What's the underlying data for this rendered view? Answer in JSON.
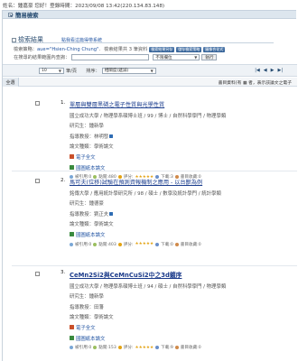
{
  "header": {
    "user_text": "姓名：鍾嘉豪 您好！登錄時間：2023/09/08 13:42(220.134.83.148)"
  },
  "panel": {
    "title": "簡易檢索"
  },
  "results": {
    "title": "檢索結果",
    "save_link": "點我看這篇得帶系統"
  },
  "query": {
    "prefix": "檢索策略：",
    "expr": "auе=\"Hsien-Ching Chung\"",
    "suffix": ".",
    "summary": "檢索結果共 3 筆資料",
    "buttons": [
      "檢索結果另存",
      "儲存檢索策略",
      "圖像合化式"
    ]
  },
  "refine": {
    "label": "在搜尋的結果範圍內查詢：",
    "field_select": "不限欄位",
    "run": "執行"
  },
  "sort": {
    "per_page": "10",
    "unit": "筆/頁",
    "sort_label": "排序：",
    "sort_select": "相關度(遞減)"
  },
  "pager": {
    "first": "|◀",
    "prev": "◀",
    "next": "▶",
    "last": "▶|"
  },
  "table": {
    "all_label": "全選",
    "note": "書目資料(有 ▦ 者，表示該論文之電子"
  },
  "records": [
    {
      "no": "1.",
      "title": "單層與雙層黑磷之電子性質與光學性質",
      "school": "國立成功大學 / 物理學系碩博士班 / 99 / 博士 / 自然科學學門 / 物理學類",
      "student": "研究生：鍾新學",
      "advisor": "指導教授：林明發",
      "format": "論文種類：學術論文",
      "fulltext": "電子全文",
      "library": "國圖紙本論文",
      "stats": [
        "被引用:0",
        "點閱:480",
        "評分:",
        "下載:3",
        "書目收藏:0"
      ],
      "bold": false
    },
    {
      "no": "2.",
      "title": "馬可夫(位移)試驗在預測資報機制之應用 - 以台獸為例",
      "school": "銘傳大學 / 應用統計學研究所 / 98 / 碩士 / 數學及統計學門 / 統計學類",
      "student": "研究生：鍾德豪",
      "advisor": "指導教授：劉正夫",
      "format": "論文種類：學術論文",
      "fulltext": "",
      "library": "國圖紙本論文",
      "stats": [
        "被引用:0",
        "點閱:403",
        "評分:",
        "下載:0",
        "書目收藏:0"
      ],
      "bold": false
    },
    {
      "no": "3.",
      "title": "CeMn2Si2與CeMnCuSi2中之3d鍍序",
      "school": "國立成功大學 / 物理學系碩博士班 / 94 / 碩士 / 自然科學學門 / 物理學類",
      "student": "研究生：鍾新學",
      "advisor": "指導教授：田藩",
      "format": "論文種類：學術論文",
      "fulltext": "電子全文",
      "library": "國圖紙本論文",
      "stats": [
        "被引用:0",
        "點閱:153",
        "評分:",
        "下載:9",
        "書目收藏:0"
      ],
      "bold": true
    }
  ]
}
